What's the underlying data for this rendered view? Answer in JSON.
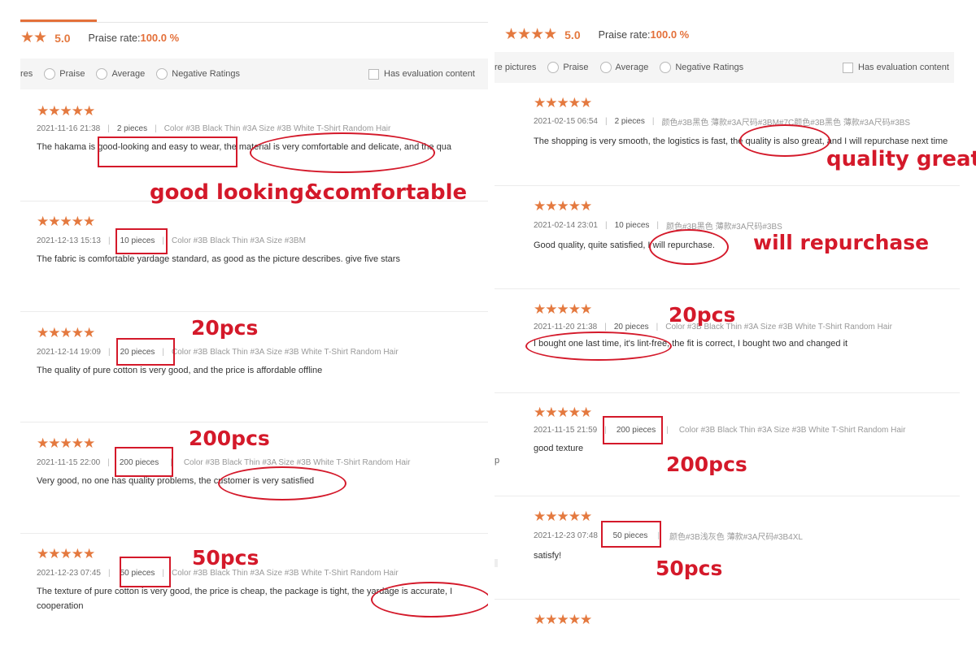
{
  "left": {
    "summary": {
      "stars": "★★",
      "score": "5.0",
      "praise_label": "Praise rate:",
      "praise_value": "100.0 %"
    },
    "filters": {
      "first": "res",
      "praise": "Praise",
      "average": "Average",
      "negative": "Negative Ratings",
      "has_content": "Has evaluation content"
    },
    "reviews": [
      {
        "stars": "★★★★★",
        "date": "2021-11-16 21:38",
        "qty": "2 pieces",
        "variant": "Color #3B Black Thin #3A Size #3B White T-Shirt Random Hair",
        "content": "The hakama is good-looking and easy to wear, the material is very comfortable and delicate, and the qua"
      },
      {
        "stars": "★★★★★",
        "date": "2021-12-13 15:13",
        "qty": "10 pieces",
        "variant": "Color #3B Black Thin #3A Size #3BM",
        "content": "The fabric is comfortable yardage standard, as good as the picture describes. give five stars"
      },
      {
        "stars": "★★★★★",
        "date": "2021-12-14 19:09",
        "qty": "20 pieces",
        "variant": "Color #3B Black Thin #3A Size #3B White T-Shirt Random Hair",
        "content": "The quality of pure cotton is very good, and the price is affordable offline"
      },
      {
        "stars": "★★★★★",
        "date": "2021-11-15 22:00",
        "qty": "200 pieces",
        "variant": "Color #3B Black Thin #3A Size #3B White T-Shirt Random Hair",
        "content": "Very good, no one has quality problems, the customer is very satisfied"
      },
      {
        "stars": "★★★★★",
        "date": "2021-12-23 07:45",
        "qty": "50 pieces",
        "variant": "Color #3B Black Thin #3A Size #3B White T-Shirt Random Hair",
        "content": "The texture of pure cotton is very good, the price is cheap, the package is tight, the yardage is accurate, I",
        "content2": "cooperation"
      }
    ],
    "annotations": {
      "a1": "good looking&comfortable",
      "a2": "20pcs",
      "a3": "200pcs",
      "a4": "50pcs"
    }
  },
  "right": {
    "summary": {
      "stars": "★★★★",
      "score": "5.0",
      "praise_label": "Praise rate:",
      "praise_value": "100.0 %"
    },
    "filters": {
      "first": "re pictures",
      "praise": "Praise",
      "average": "Average",
      "negative": "Negative Ratings",
      "has_content": "Has evaluation content"
    },
    "reviews": [
      {
        "stars": "★★★★★",
        "date": "2021-02-15 06:54",
        "qty": "2 pieces",
        "variant": "颜色#3B黑色 薄款#3A尺码#3BM#7C颜色#3B黑色 薄款#3A尺码#3BS",
        "content": "The shopping is very smooth, the logistics is fast, the quality is also great, and I will repurchase next time"
      },
      {
        "stars": "★★★★★",
        "date": "2021-02-14 23:01",
        "qty": "10 pieces",
        "variant": "颜色#3B黑色 薄款#3A尺码#3BS",
        "content": "Good quality, quite satisfied, I will repurchase."
      },
      {
        "stars": "★★★★★",
        "date": "2021-11-20 21:38",
        "qty": "20 pieces",
        "variant": "Color #3B Black Thin #3A Size #3B White T-Shirt Random Hair",
        "content": "I bought one last time, it's lint-free, the fit is correct, I bought two and changed it"
      },
      {
        "stars": "★★★★★",
        "date": "2021-11-15 21:59",
        "qty": "200 pieces",
        "variant": "Color #3B Black Thin #3A Size #3B White T-Shirt Random Hair",
        "content": "good texture"
      },
      {
        "stars": "★★★★★",
        "date": "2021-12-23 07:48",
        "qty": "50 pieces",
        "variant": "颜色#3B浅灰色 薄款#3A尺码#3B4XL",
        "content": "satisfy!"
      },
      {
        "stars": "★★★★★"
      }
    ],
    "annotations": {
      "a1": "quality great",
      "a2": "will repurchase",
      "a3": "20pcs",
      "a4": "200pcs",
      "a5": "50pcs"
    },
    "stray": {
      "p": "p"
    }
  },
  "colors": {
    "accent": "#e4793f",
    "annotation_red": "#d4192a"
  }
}
